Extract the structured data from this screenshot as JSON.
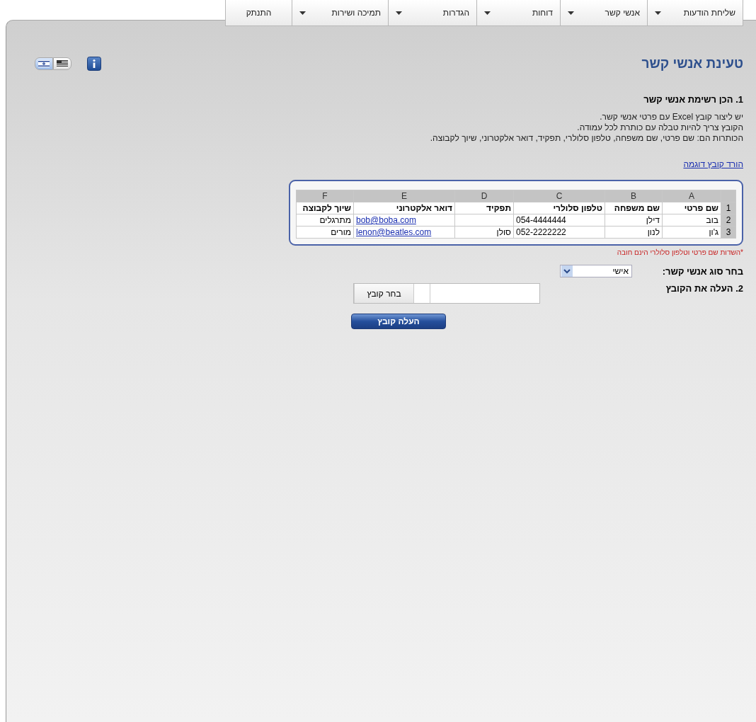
{
  "menu": [
    {
      "label": "שליחת הודעות",
      "has_dropdown": true
    },
    {
      "label": "אנשי קשר",
      "has_dropdown": true
    },
    {
      "label": "דוחות",
      "has_dropdown": true
    },
    {
      "label": "הגדרות",
      "has_dropdown": true
    },
    {
      "label": "תמיכה ושירות",
      "has_dropdown": true
    },
    {
      "label": "התנתק",
      "has_dropdown": false
    }
  ],
  "title": "טעינת אנשי קשר",
  "languages": [
    {
      "kind": "il",
      "selected": true
    },
    {
      "kind": "us",
      "selected": false
    }
  ],
  "step1": {
    "heading": "1. הכן רשימת אנשי קשר",
    "lines": [
      "יש ליצור קובץ Excel עם פרטי אנשי קשר.",
      "הקובץ צריך להיות טבלה עם כותרת לכל עמודה.",
      "הכותרות הם: שם פרטי, שם משפחה, טלפון סלולרי, תפקיד, דואר אלקטרוני, שיוך לקבוצה."
    ],
    "download_link": "הורד קובץ דוגמה"
  },
  "spreadsheet": {
    "columns": [
      "A",
      "B",
      "C",
      "D",
      "E",
      "F"
    ],
    "rows": [
      {
        "number": "1",
        "kind": "header",
        "cells": [
          {
            "text": "שם פרטי",
            "kind": "text"
          },
          {
            "text": "שם משפחה",
            "kind": "text"
          },
          {
            "text": "טלפון סלולרי",
            "kind": "text"
          },
          {
            "text": "תפקיד",
            "kind": "text"
          },
          {
            "text": "דואר אלקטרוני",
            "kind": "text"
          },
          {
            "text": "שיוך לקבוצה",
            "kind": "text"
          }
        ]
      },
      {
        "number": "2",
        "kind": "data",
        "cells": [
          {
            "text": "בוב",
            "kind": "text"
          },
          {
            "text": "דילן",
            "kind": "text"
          },
          {
            "text": "054-4444444",
            "kind": "text"
          },
          {
            "text": "",
            "kind": "text"
          },
          {
            "text": "bob@boba.com",
            "kind": "link"
          },
          {
            "text": "מתרגלים",
            "kind": "text"
          }
        ]
      },
      {
        "number": "3",
        "kind": "data",
        "cells": [
          {
            "text": "ג'ון",
            "kind": "text"
          },
          {
            "text": "לנון",
            "kind": "text"
          },
          {
            "text": "052-2222222",
            "kind": "text"
          },
          {
            "text": "סולן",
            "kind": "text"
          },
          {
            "text": "lenon@beatles.com",
            "kind": "link"
          },
          {
            "text": "מורים",
            "kind": "text"
          }
        ]
      }
    ]
  },
  "required_note": "*השדות שם פרטי וטלפון סלולרי הינם חובה",
  "contact_type": {
    "label": "בחר סוג אנשי קשר:",
    "value": "אישי"
  },
  "step2": {
    "heading": "2. העלה את הקובץ",
    "browse_button": "בחר קובץ",
    "upload_button": "העלה קובץ"
  }
}
